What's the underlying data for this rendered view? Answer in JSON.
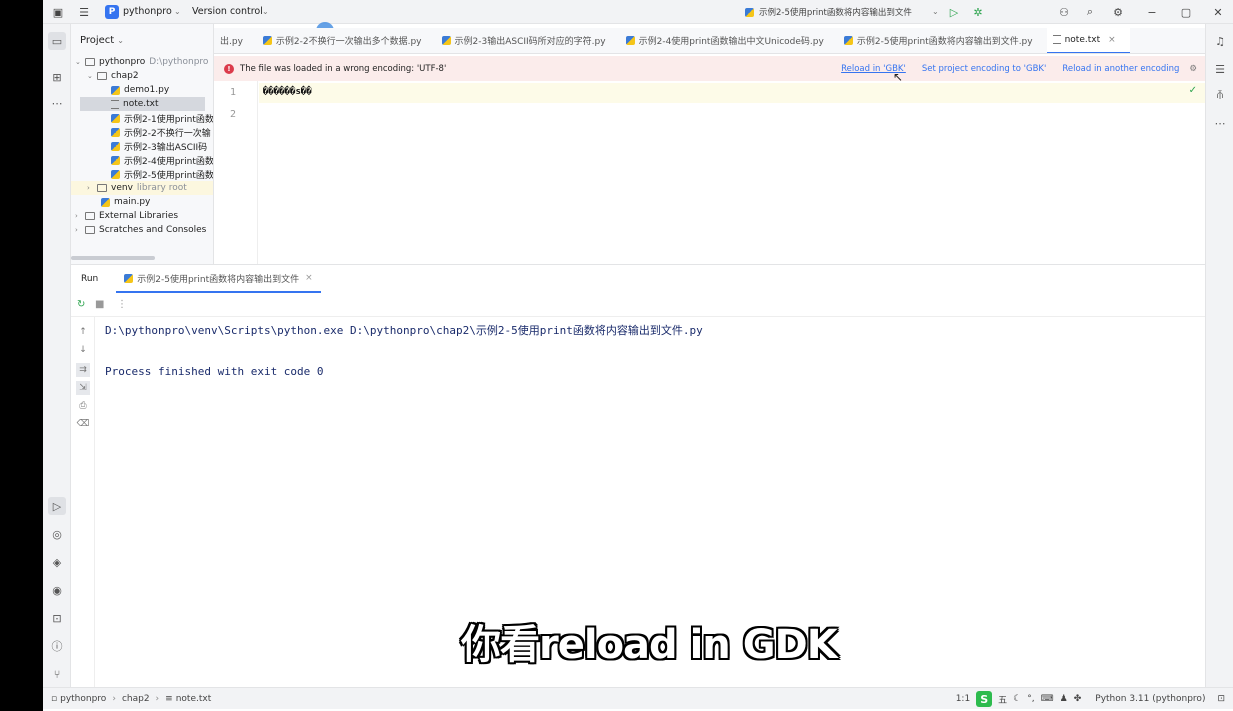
{
  "topbar": {
    "project_badge": "P",
    "project_name": "pythonpro",
    "vcs": "Version control",
    "run_config": "示例2-5使用print函数将内容输出到文件"
  },
  "project_panel": {
    "title": "Project",
    "items": [
      {
        "label": "pythonpro",
        "hint": "D:\\pythonpro"
      },
      {
        "label": "chap2"
      },
      {
        "label": "demo1.py"
      },
      {
        "label": "note.txt"
      },
      {
        "label": "示例2-1使用print函数"
      },
      {
        "label": "示例2-2不换行一次输"
      },
      {
        "label": "示例2-3输出ASCII码"
      },
      {
        "label": "示例2-4使用print函数"
      },
      {
        "label": "示例2-5使用print函数"
      },
      {
        "label": "venv",
        "hint": "library root"
      },
      {
        "label": "main.py"
      },
      {
        "label": "External Libraries"
      },
      {
        "label": "Scratches and Consoles"
      }
    ]
  },
  "editor": {
    "tabs": [
      {
        "label": "出.py"
      },
      {
        "label": "示例2-2不换行一次输出多个数据.py"
      },
      {
        "label": "示例2-3输出ASCII码所对应的字符.py"
      },
      {
        "label": "示例2-4使用print函数输出中文Unicode码.py"
      },
      {
        "label": "示例2-5使用print函数将内容输出到文件.py"
      },
      {
        "label": "note.txt"
      }
    ],
    "notice": {
      "message": "The file was loaded in a wrong encoding: 'UTF-8'",
      "action1": "Reload in 'GBK'",
      "action2": "Set project encoding to 'GBK'",
      "action3": "Reload in another encoding"
    },
    "line_numbers": [
      "1",
      "2"
    ],
    "line1": "������s��"
  },
  "run": {
    "title": "Run",
    "tab": "示例2-5使用print函数将内容输出到文件",
    "line1": "D:\\pythonpro\\venv\\Scripts\\python.exe D:\\pythonpro\\chap2\\示例2-5使用print函数将内容输出到文件.py",
    "line2": "Process finished with exit code 0"
  },
  "subtitle": "你看reload in GDK",
  "status": {
    "breadcrumb": [
      "pythonpro",
      "chap2",
      "note.txt"
    ],
    "position": "1:1",
    "ime": "S",
    "ime_text": "五",
    "interpreter": "Python 3.11 (pythonpro)"
  }
}
